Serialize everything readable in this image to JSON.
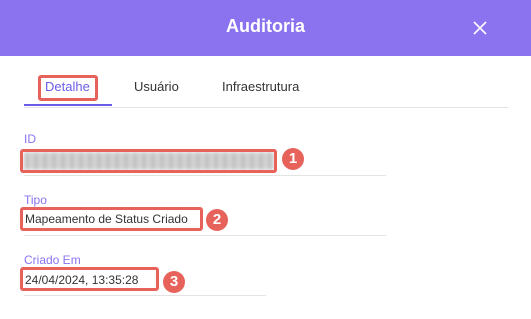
{
  "header": {
    "title": "Auditoria"
  },
  "tabs": [
    {
      "label": "Detalhe"
    },
    {
      "label": "Usuário"
    },
    {
      "label": "Infraestrutura"
    }
  ],
  "fields": [
    {
      "label": "ID",
      "value": ""
    },
    {
      "label": "Tipo",
      "value": "Mapeamento de Status Criado"
    },
    {
      "label": "Criado Em",
      "value": "24/04/2024, 13:35:28"
    }
  ],
  "badges": [
    "1",
    "2",
    "3"
  ],
  "colors": {
    "header": "#8b73f0",
    "accent": "#6b5ce7",
    "highlight": "#e8625c"
  }
}
